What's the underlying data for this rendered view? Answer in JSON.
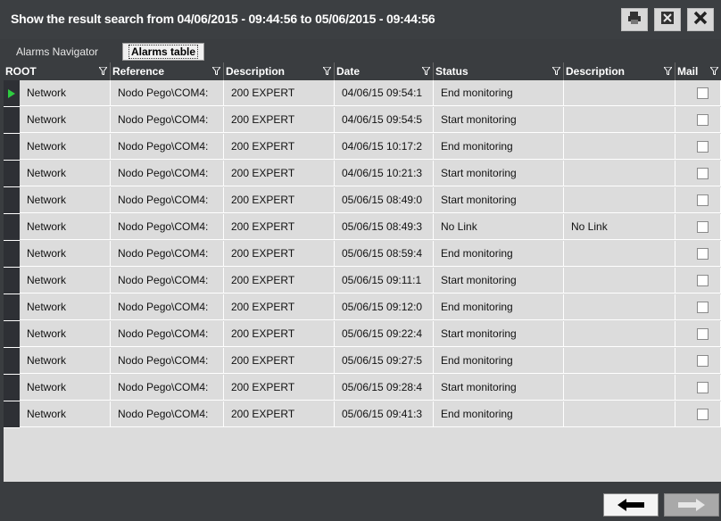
{
  "window": {
    "title": "Show the result search from 04/06/2015 - 09:44:56 to 05/06/2015 - 09:44:56",
    "buttons": [
      {
        "icon": "print-icon"
      },
      {
        "icon": "export-icon"
      },
      {
        "icon": "close-icon"
      }
    ]
  },
  "tabs": [
    {
      "label": "Alarms Navigator",
      "active": false
    },
    {
      "label": "Alarms table",
      "active": true
    }
  ],
  "table": {
    "columns": [
      "ROOT",
      "Reference",
      "Description",
      "Date",
      "Status",
      "Description",
      "Mail"
    ],
    "rows": [
      {
        "root": "Network",
        "reference": "Nodo Pego\\COM4:",
        "description": "200 EXPERT",
        "date": "04/06/15 09:54:1",
        "status": "End monitoring",
        "description2": "",
        "mail": false,
        "selected": true
      },
      {
        "root": "Network",
        "reference": "Nodo Pego\\COM4:",
        "description": "200 EXPERT",
        "date": "04/06/15 09:54:5",
        "status": "Start monitoring",
        "description2": "",
        "mail": false
      },
      {
        "root": "Network",
        "reference": "Nodo Pego\\COM4:",
        "description": "200 EXPERT",
        "date": "04/06/15 10:17:2",
        "status": "End monitoring",
        "description2": "",
        "mail": false
      },
      {
        "root": "Network",
        "reference": "Nodo Pego\\COM4:",
        "description": "200 EXPERT",
        "date": "04/06/15 10:21:3",
        "status": "Start monitoring",
        "description2": "",
        "mail": false
      },
      {
        "root": "Network",
        "reference": "Nodo Pego\\COM4:",
        "description": "200 EXPERT",
        "date": "05/06/15 08:49:0",
        "status": "Start monitoring",
        "description2": "",
        "mail": false
      },
      {
        "root": "Network",
        "reference": "Nodo Pego\\COM4:",
        "description": "200 EXPERT",
        "date": "05/06/15 08:49:3",
        "status": "No Link",
        "description2": "No Link",
        "mail": false
      },
      {
        "root": "Network",
        "reference": "Nodo Pego\\COM4:",
        "description": "200 EXPERT",
        "date": "05/06/15 08:59:4",
        "status": "End monitoring",
        "description2": "",
        "mail": false
      },
      {
        "root": "Network",
        "reference": "Nodo Pego\\COM4:",
        "description": "200 EXPERT",
        "date": "05/06/15 09:11:1",
        "status": "Start monitoring",
        "description2": "",
        "mail": false
      },
      {
        "root": "Network",
        "reference": "Nodo Pego\\COM4:",
        "description": "200 EXPERT",
        "date": "05/06/15 09:12:0",
        "status": "End monitoring",
        "description2": "",
        "mail": false
      },
      {
        "root": "Network",
        "reference": "Nodo Pego\\COM4:",
        "description": "200 EXPERT",
        "date": "05/06/15 09:22:4",
        "status": "Start monitoring",
        "description2": "",
        "mail": false
      },
      {
        "root": "Network",
        "reference": "Nodo Pego\\COM4:",
        "description": "200 EXPERT",
        "date": "05/06/15 09:27:5",
        "status": "End monitoring",
        "description2": "",
        "mail": false
      },
      {
        "root": "Network",
        "reference": "Nodo Pego\\COM4:",
        "description": "200 EXPERT",
        "date": "05/06/15 09:28:4",
        "status": "Start monitoring",
        "description2": "",
        "mail": false
      },
      {
        "root": "Network",
        "reference": "Nodo Pego\\COM4:",
        "description": "200 EXPERT",
        "date": "05/06/15 09:41:3",
        "status": "End monitoring",
        "description2": "",
        "mail": false
      }
    ]
  },
  "pagination": {
    "prev_icon": "arrow-left-icon",
    "next_icon": "arrow-right-icon",
    "next_enabled": false
  }
}
